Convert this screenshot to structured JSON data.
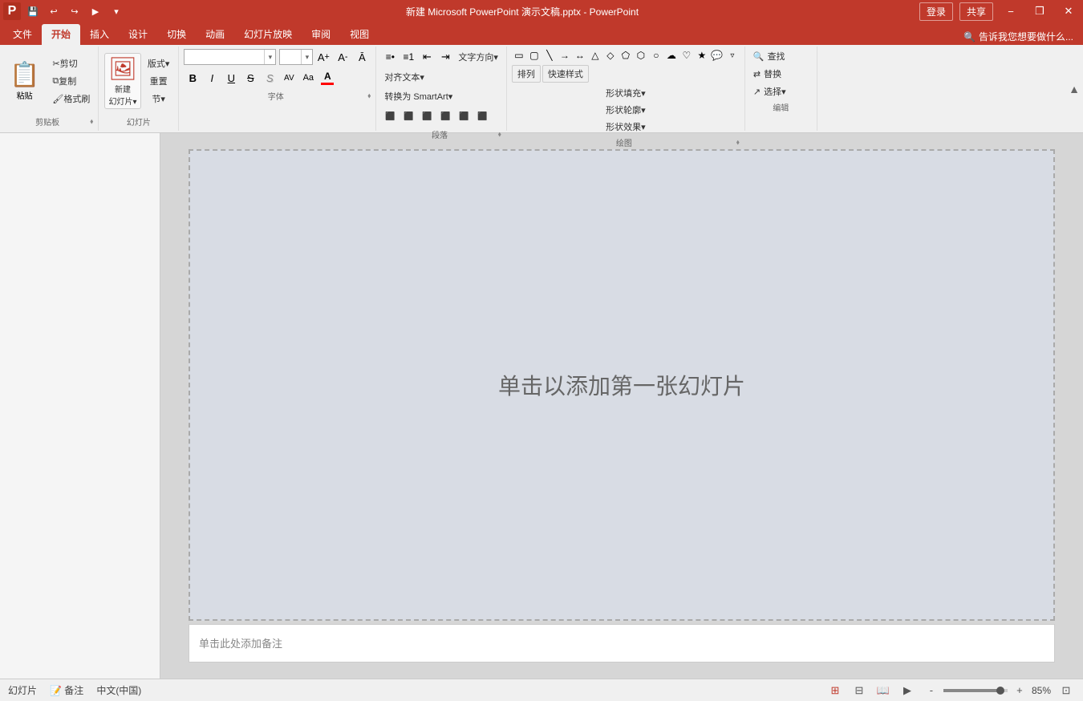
{
  "titlebar": {
    "title": "新建 Microsoft PowerPoint 演示文稿.pptx - PowerPoint",
    "quick_access": [
      "save",
      "undo",
      "redo",
      "customize"
    ],
    "window_controls": [
      "minimize",
      "restore",
      "close"
    ]
  },
  "ribbon": {
    "tabs": [
      "文件",
      "开始",
      "插入",
      "设计",
      "切换",
      "动画",
      "幻灯片放映",
      "审阅",
      "视图"
    ],
    "active_tab": "开始",
    "search_placeholder": "告诉我您想要做什么...",
    "user": {
      "login": "登录",
      "share": "共享"
    },
    "groups": {
      "clipboard": {
        "label": "剪贴板",
        "paste": "粘贴",
        "cut": "剪切",
        "copy": "复制",
        "format_painter": "格式刷"
      },
      "slides": {
        "label": "幻灯片",
        "new_slide": "新建\n幻灯片▾",
        "layout": "版式▾",
        "reset": "重置",
        "section": "节▾"
      },
      "font": {
        "label": "字体",
        "font_name": "",
        "font_size": "",
        "increase_size": "A↑",
        "decrease_size": "A↓",
        "clear_format": "清除",
        "bold": "B",
        "italic": "I",
        "underline": "U",
        "strikethrough": "S",
        "shadow": "S",
        "spacing": "间距",
        "case": "Aa",
        "font_color": "A",
        "font_color_bar": "#ff0000"
      },
      "paragraph": {
        "label": "段落",
        "bullet_list": "≡•",
        "num_list": "≡1",
        "decrease_indent": "←",
        "increase_indent": "→",
        "direction": "文字方向▾",
        "align_text": "对齐文本▾",
        "convert_smartart": "转换为 SmartArt▾",
        "align_left": "⬛",
        "align_center": "⬛",
        "align_right": "⬛",
        "justify": "⬛",
        "distribute": "⬛",
        "line_spacing": "⬛",
        "cols": "⬛"
      },
      "drawing": {
        "label": "绘图",
        "shapes": [
          "▭",
          "▷",
          "◇",
          "⬭",
          "⬡",
          "⬒",
          "⬓",
          "⋮",
          "▿",
          "◠",
          "⌒",
          "⊓"
        ]
      },
      "arrange": {
        "label": "排列"
      },
      "quick_styles": {
        "label": "快速样式"
      },
      "shape_fill": "形状填充▾",
      "shape_outline": "形状轮廓▾",
      "shape_effects": "形状效果▾",
      "edit": {
        "label": "编辑",
        "find": "查找",
        "replace": "替换",
        "select": "选择▾"
      }
    }
  },
  "canvas": {
    "placeholder": "单击以添加第一张幻灯片",
    "notes_placeholder": "单击此处添加备注"
  },
  "statusbar": {
    "slide_info": "幻灯片",
    "language": "中文(中国)",
    "notes": "备注",
    "zoom": "85%",
    "view_buttons": [
      "普通",
      "幻灯片浏览",
      "阅读视图",
      "幻灯片放映"
    ]
  }
}
